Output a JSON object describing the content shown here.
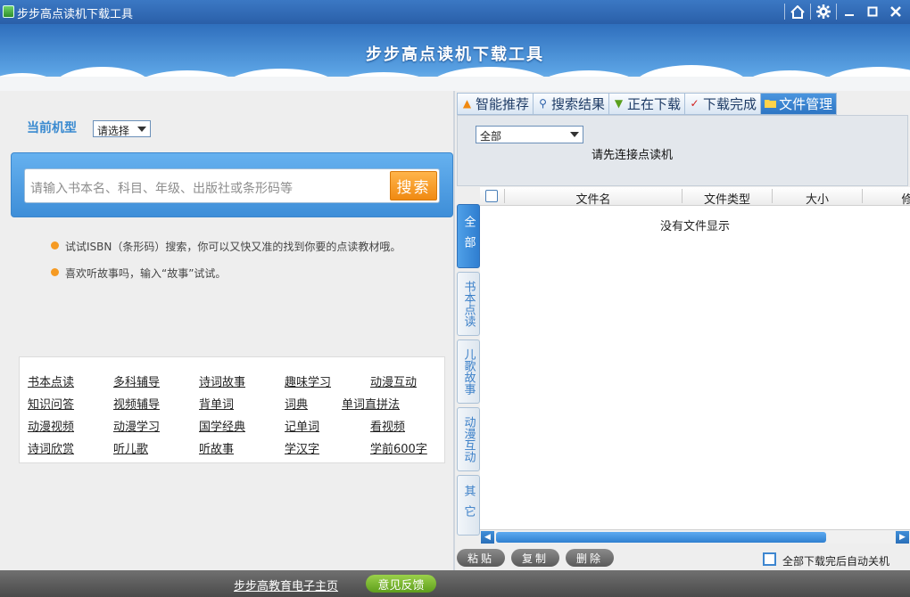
{
  "window": {
    "title": "步步高点读机下载工具",
    "controls": [
      "home-icon",
      "gear-icon",
      "minimize-icon",
      "maximize-icon",
      "close-icon"
    ]
  },
  "banner": {
    "title": "步步高点读机下载工具"
  },
  "left": {
    "model_label": "当前机型",
    "model_select": "请选择",
    "search_placeholder": "请输入书本名、科目、年级、出版社或条形码等",
    "search_button": "搜索",
    "tips": [
      "试试ISBN（条形码）搜索，你可以又快又准的找到你要的点读教材哦。",
      "喜欢听故事吗，输入“故事”试试。"
    ],
    "links": [
      [
        "书本点读",
        "多科辅导",
        "诗词故事",
        "趣味学习",
        "动漫互动"
      ],
      [
        "知识问答",
        "视频辅导",
        "背单词",
        "词典",
        "单词直拼法"
      ],
      [
        "动漫视频",
        "动漫学习",
        "国学经典",
        "记单词",
        "看视频"
      ],
      [
        "诗词欣赏",
        "听儿歌",
        "听故事",
        "学汉字",
        "学前600字"
      ]
    ]
  },
  "right": {
    "tabs": [
      {
        "label": "智能推荐",
        "icon": "flame-icon"
      },
      {
        "label": "搜索结果",
        "icon": "magnifier-icon"
      },
      {
        "label": "正在下载",
        "icon": "download-arrow-icon"
      },
      {
        "label": "下载完成",
        "icon": "checkmark-icon"
      },
      {
        "label": "文件管理",
        "icon": "folder-icon"
      }
    ],
    "filter_select": "全部",
    "connect_message": "请先连接点读机",
    "columns": [
      "文件名",
      "文件类型",
      "大小",
      "修"
    ],
    "empty_message": "没有文件显示",
    "categories": [
      "全部",
      "书本点读",
      "儿歌故事",
      "动漫互动",
      "其它"
    ],
    "actions": [
      "粘贴",
      "复制",
      "删除"
    ],
    "auto_shutdown_label": "全部下载完后自动关机"
  },
  "footer": {
    "home_link": "步步高教育电子主页",
    "feedback_button": "意见反馈"
  },
  "colors": {
    "titlebar": "#2a5fa8",
    "accent_blue": "#3a8ad0",
    "search_button": "#f08a12",
    "feedback_button": "#7ab832"
  }
}
